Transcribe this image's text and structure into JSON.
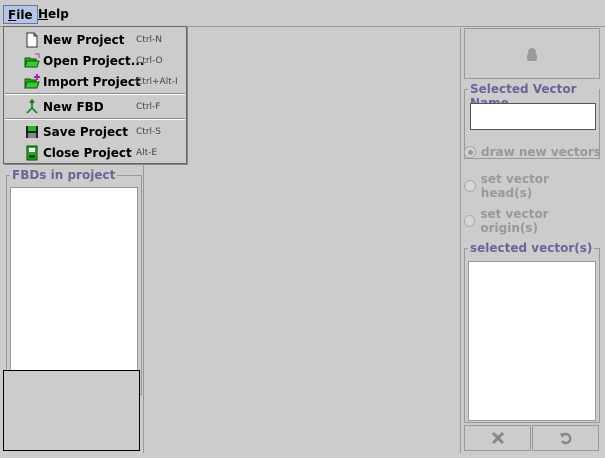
{
  "menubar": {
    "file": {
      "label_first": "F",
      "label_rest": "ile"
    },
    "help": {
      "label_first": "H",
      "label_rest": "elp"
    }
  },
  "file_menu": {
    "items": [
      {
        "label": "New Project",
        "accel": "Ctrl-N",
        "icon": "new-document-icon"
      },
      {
        "label": "Open Project...",
        "accel": "Ctrl-O",
        "icon": "open-folder-icon"
      },
      {
        "label": "Import Project",
        "accel": "Ctrl+Alt-I",
        "icon": "import-folder-icon"
      },
      {
        "label": "New FBD",
        "accel": "Ctrl-F",
        "icon": "new-fbd-icon"
      },
      {
        "label": "Save Project",
        "accel": "Ctrl-S",
        "icon": "save-icon"
      },
      {
        "label": "Close Project",
        "accel": "Alt-E",
        "icon": "close-project-icon"
      }
    ]
  },
  "left_panel": {
    "fbds_title": "FBDs in project"
  },
  "right_panel": {
    "color_button_icon": "lock-icon",
    "selected_vector_name_title": "Selected Vector Name",
    "selected_vector_name_value": "",
    "radios": [
      {
        "label": "draw new vectors",
        "checked": true
      },
      {
        "label": "set vector head(s)",
        "checked": false
      },
      {
        "label": "set vector origin(s)",
        "checked": false
      }
    ],
    "selected_vectors_title": "selected vector(s)",
    "delete_icon": "delete-x-icon",
    "undo_icon": "undo-icon"
  },
  "colors": {
    "background": "#cccccc",
    "group_title": "#666699",
    "menu_highlight": "#b8c4e6",
    "disabled_text": "#999999"
  }
}
